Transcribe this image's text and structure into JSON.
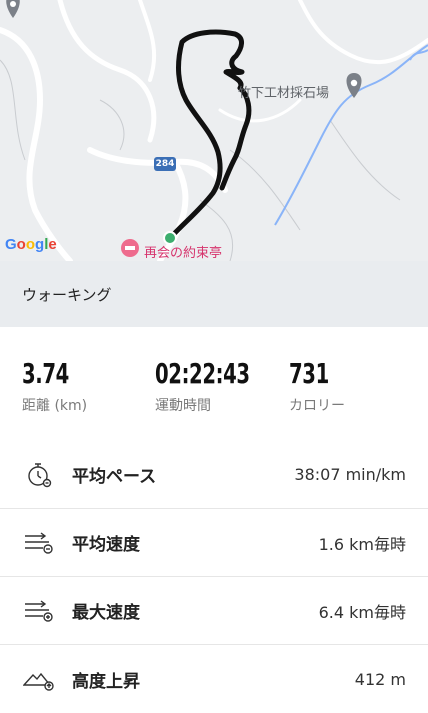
{
  "map": {
    "logo": "Google",
    "road_number": "284",
    "place_label": "竹下工材採石場",
    "poi_label": "再会の約束亭"
  },
  "activity": {
    "type": "ウォーキング"
  },
  "summary": [
    {
      "value": "3.74",
      "label": "距離 (km)"
    },
    {
      "value": "02:22:43",
      "label": "運動時間"
    },
    {
      "value": "731",
      "label": "カロリー"
    }
  ],
  "metrics": [
    {
      "icon": "stopwatch-icon",
      "name": "平均ペース",
      "value": "38:07 min/km"
    },
    {
      "icon": "speed-icon",
      "name": "平均速度",
      "value": "1.6 km毎時"
    },
    {
      "icon": "max-speed-icon",
      "name": "最大速度",
      "value": "6.4 km毎時"
    },
    {
      "icon": "elevation-icon",
      "name": "高度上昇",
      "value": "412 m"
    }
  ]
}
